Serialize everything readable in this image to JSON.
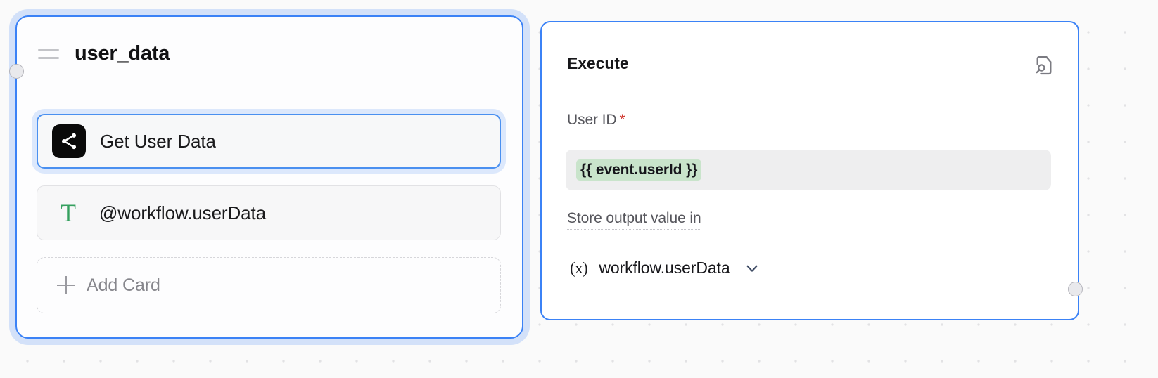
{
  "canvas": {
    "background_color": "#fafafa",
    "grid_dot_color": "#e2e2e4"
  },
  "nodes": [
    {
      "id": "user_data",
      "title": "user_data",
      "selected": true,
      "accent_color": "#3b82f6",
      "drag_handle_icon": "drag-handle-icon",
      "cards": [
        {
          "label": "Get User Data",
          "icon": "share-nodes-icon",
          "icon_background": "#0a0a0a",
          "icon_color": "#ffffff",
          "selected": true
        },
        {
          "label": "@workflow.userData",
          "icon": "text-type-icon",
          "icon_color": "#35a05f",
          "selected": false
        }
      ],
      "add_card": {
        "label": "Add Card",
        "icon": "plus-icon"
      }
    },
    {
      "id": "execute",
      "title": "Execute",
      "accent_color": "#3b82f6",
      "header_icon": "file-search-icon",
      "fields": [
        {
          "label": "User ID",
          "required": true,
          "required_marker": "*",
          "required_color": "#d0342c",
          "value": "{{ event.userId }}",
          "value_chip_color": "#c9e4cb",
          "input_background": "#eeeeef"
        },
        {
          "label": "Store output value in",
          "required": false,
          "icon": "variable-icon",
          "icon_glyph": "(x)",
          "value": "workflow.userData",
          "dropdown_icon": "chevron-down-icon"
        }
      ]
    }
  ],
  "ports": [
    {
      "name": "left-input-port",
      "color": "#e9e9ec"
    },
    {
      "name": "right-input-port",
      "color": "#e9e9ec"
    }
  ]
}
